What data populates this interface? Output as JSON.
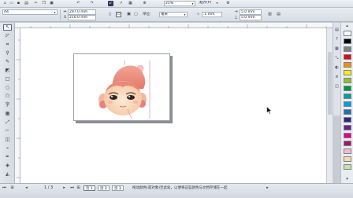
{
  "standard_toolbar": {
    "icons": [
      "new-icon",
      "open-icon",
      "save-icon",
      "print-icon",
      "cut-icon",
      "copy-icon",
      "paste-icon",
      "undo-icon",
      "redo-icon",
      "import-icon",
      "export-icon",
      "launcher-icon",
      "zoom-icon"
    ],
    "zoom_value": "25%",
    "snap_label": "贴齐(P)"
  },
  "property_bar": {
    "page_size": "A4",
    "width_value": "297.0 mm",
    "height_value": "210.0 mm",
    "units_label": "单位:",
    "units_value": "毫米",
    "nudge_value": ".1 mm",
    "dup_x_value": "5.0 mm",
    "dup_y_value": "5.0 mm"
  },
  "toolbox": {
    "tools": [
      "pick-tool-icon",
      "shape-tool-icon",
      "crop-tool-icon",
      "zoom-tool-icon",
      "freehand-tool-icon",
      "smart-fill-icon",
      "rectangle-tool-icon",
      "ellipse-tool-icon",
      "polygon-tool-icon",
      "text-tool-icon",
      "table-tool-icon",
      "parallel-dimension-icon",
      "connector-tool-icon",
      "blend-tool-icon",
      "dropper-tool-icon",
      "outline-pen-icon",
      "fill-tool-icon",
      "interactive-fill-icon"
    ]
  },
  "palette": {
    "colors": [
      "#ffffff",
      "#000000",
      "#7f7f7f",
      "#e30613",
      "#f39200",
      "#ffed00",
      "#95c11f",
      "#009640",
      "#00a19a",
      "#009fe3",
      "#1d71b8",
      "#312783",
      "#662483",
      "#e6007e",
      "#a3195b",
      "#f8b9cb",
      "#fdd7a8",
      "#c9e1a1"
    ]
  },
  "status_bar": {
    "page_counter": "1 / 3",
    "pages": [
      "页 1",
      "页 2",
      "页 3"
    ],
    "info_text": "拖动颜色(或对象)至此处，以便将这些颜色与文档存储在一起"
  }
}
